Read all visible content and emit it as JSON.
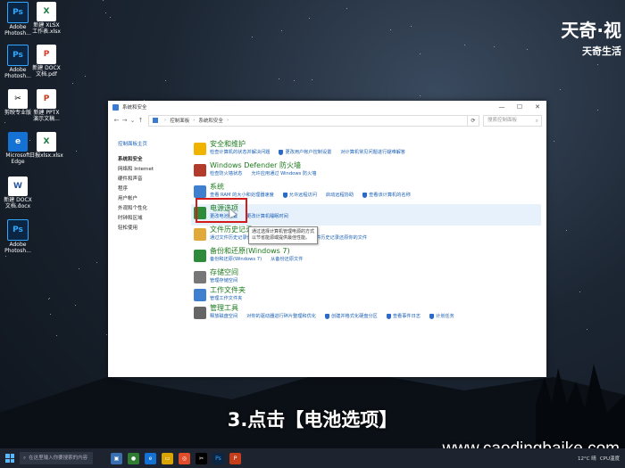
{
  "desktop": {
    "icons": [
      {
        "glyph": "Ps",
        "label": "Adobe\nPhotosh...",
        "kind": "ps"
      },
      {
        "glyph": "X",
        "label": "新建 XLSX\n工作表.xlsx",
        "kind": "xl"
      },
      {
        "glyph": "Ps",
        "label": "Adobe\nPhotosh...",
        "kind": "ps"
      },
      {
        "glyph": "P",
        "label": "新建 DOCX\n文档.pdf",
        "kind": "pdf"
      },
      {
        "glyph": "✂",
        "label": "剪映专业版",
        "kind": "capcut"
      },
      {
        "glyph": "P",
        "label": "新建 PPTX\n演示文稿...",
        "kind": "ppt"
      },
      {
        "glyph": "e",
        "label": "Microsoft\nEdge",
        "kind": "edge"
      },
      {
        "glyph": "X",
        "label": "日报xlsx.xlsx",
        "kind": "xl"
      },
      {
        "glyph": "W",
        "label": "新建 DOCX\n文档.docx",
        "kind": "doc"
      },
      {
        "glyph": "Ps",
        "label": "Adobe\nPhotosh...",
        "kind": "ps"
      }
    ]
  },
  "watermark_top": {
    "main": "天奇·视",
    "sub": "天奇生活"
  },
  "window": {
    "title": "系统和安全",
    "min": "—",
    "max": "☐",
    "close": "✕",
    "nav": {
      "back": "←",
      "forward": "→",
      "down": "⌄",
      "up": "↑"
    },
    "breadcrumbs": [
      "控制面板",
      "系统和安全"
    ],
    "refresh": "⟳",
    "search_placeholder": "搜索控制面板",
    "sidebar": {
      "home": "控制面板主页",
      "items": [
        "系统和安全",
        "网络和 Internet",
        "硬件和声音",
        "程序",
        "用户帐户",
        "外观和个性化",
        "时钟和区域",
        "轻松使用"
      ]
    },
    "categories": [
      {
        "title": "安全和维护",
        "links": [
          "检查计算机的状态并解决问题",
          "更改用户帐户控制设置",
          "对计算机常见问题进行疑难解答"
        ],
        "shield": [
          false,
          true,
          false
        ]
      },
      {
        "title": "Windows Defender 防火墙",
        "links": [
          "检查防火墙状态",
          "允许应用通过 Windows 防火墙"
        ],
        "shield": [
          false,
          false
        ]
      },
      {
        "title": "系统",
        "links": [
          "查看 RAM 的大小和处理器速度",
          "允许远程访问",
          "启动远程协助",
          "查看该计算机的名称"
        ],
        "shield": [
          false,
          true,
          false,
          true
        ]
      },
      {
        "title": "电源选项",
        "links": [
          "更改电池设置",
          "更改计算机睡眠时间"
        ],
        "shield": [
          false,
          false
        ]
      },
      {
        "title": "文件历史记录",
        "links": [
          "通过文件历史记录保存你的文件备份副本",
          "使用文件历史记录还原你的文件"
        ],
        "shield": [
          false,
          false
        ]
      },
      {
        "title": "备份和还原(Windows 7)",
        "links": [
          "备份和还原(Windows 7)",
          "从备份还原文件"
        ],
        "shield": [
          false,
          false
        ]
      },
      {
        "title": "存储空间",
        "links": [
          "管理存储空间"
        ],
        "shield": [
          false
        ]
      },
      {
        "title": "工作文件夹",
        "links": [
          "管理工作文件夹"
        ],
        "shield": [
          false
        ]
      },
      {
        "title": "管理工具",
        "links": [
          "释放磁盘空间",
          "对你的驱动器进行碎片整理和优化",
          "创建并格式化硬盘分区",
          "查看事件日志",
          "计划任务"
        ],
        "shield": [
          false,
          false,
          true,
          true,
          true
        ]
      }
    ],
    "tooltip": "通过选择计算机管理电源的方式以节省能源或提供最佳性能。"
  },
  "caption": "3.点击【电池选项】",
  "watermark_bottom": "www.caodingbaike.com",
  "taskbar": {
    "search_placeholder": "在这里输入你要搜索的内容",
    "tray_text": "12°C 晴",
    "tray_cpu": "CPU温度"
  },
  "colors": {
    "category_title": "#1e7b1e",
    "link": "#1a5fb4",
    "highlight_box": "#d21b1b",
    "row_highlight": "#e6f1fc"
  }
}
